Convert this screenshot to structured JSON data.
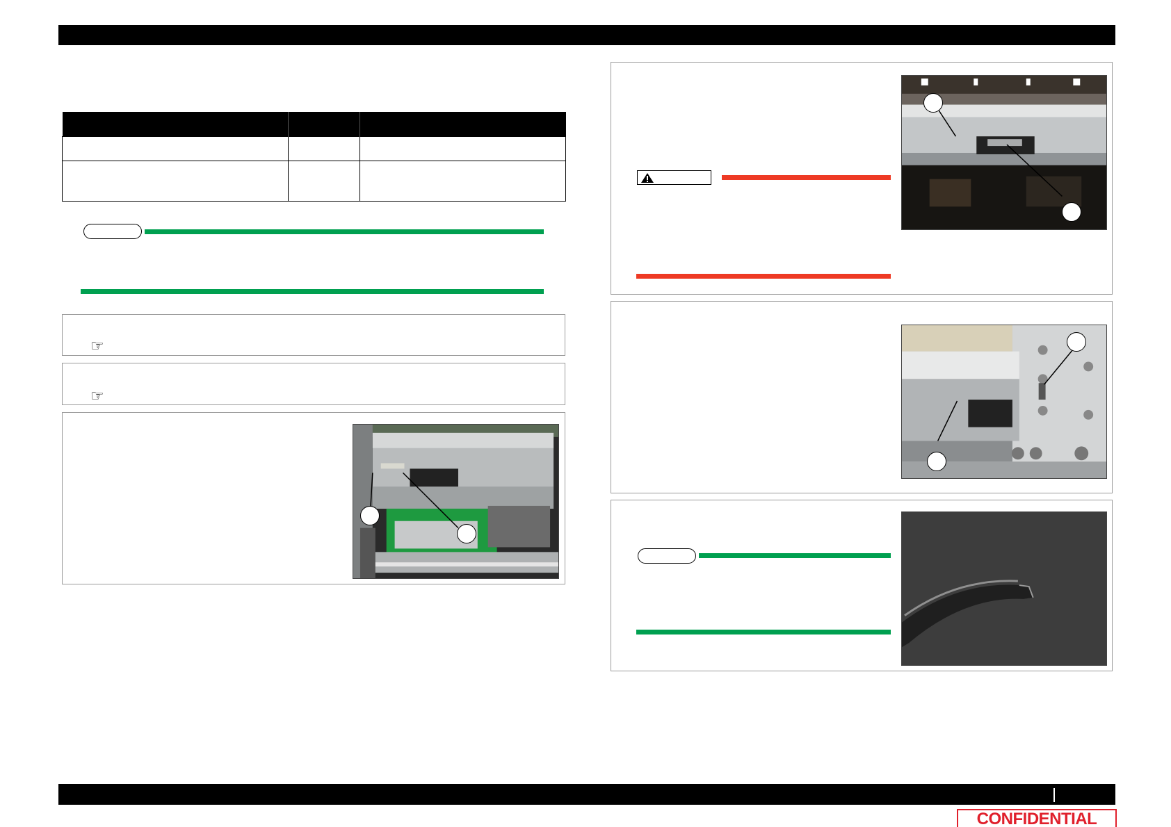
{
  "header": {
    "title": ""
  },
  "footer": {
    "text": "",
    "page_number": ""
  },
  "confidential_stamp": "CONFIDENTIAL",
  "parts_table": {
    "headers": [
      "",
      "",
      ""
    ],
    "rows": [
      [
        "",
        "",
        ""
      ],
      [
        "",
        "",
        ""
      ]
    ]
  },
  "icons": {
    "reference": "pointing-hand-icon",
    "warning": "warning-triangle-icon"
  },
  "colors": {
    "note_line": "#00a050",
    "warning_line": "#ee3a24",
    "confidential": "#e0202c",
    "bars": "#000000"
  }
}
